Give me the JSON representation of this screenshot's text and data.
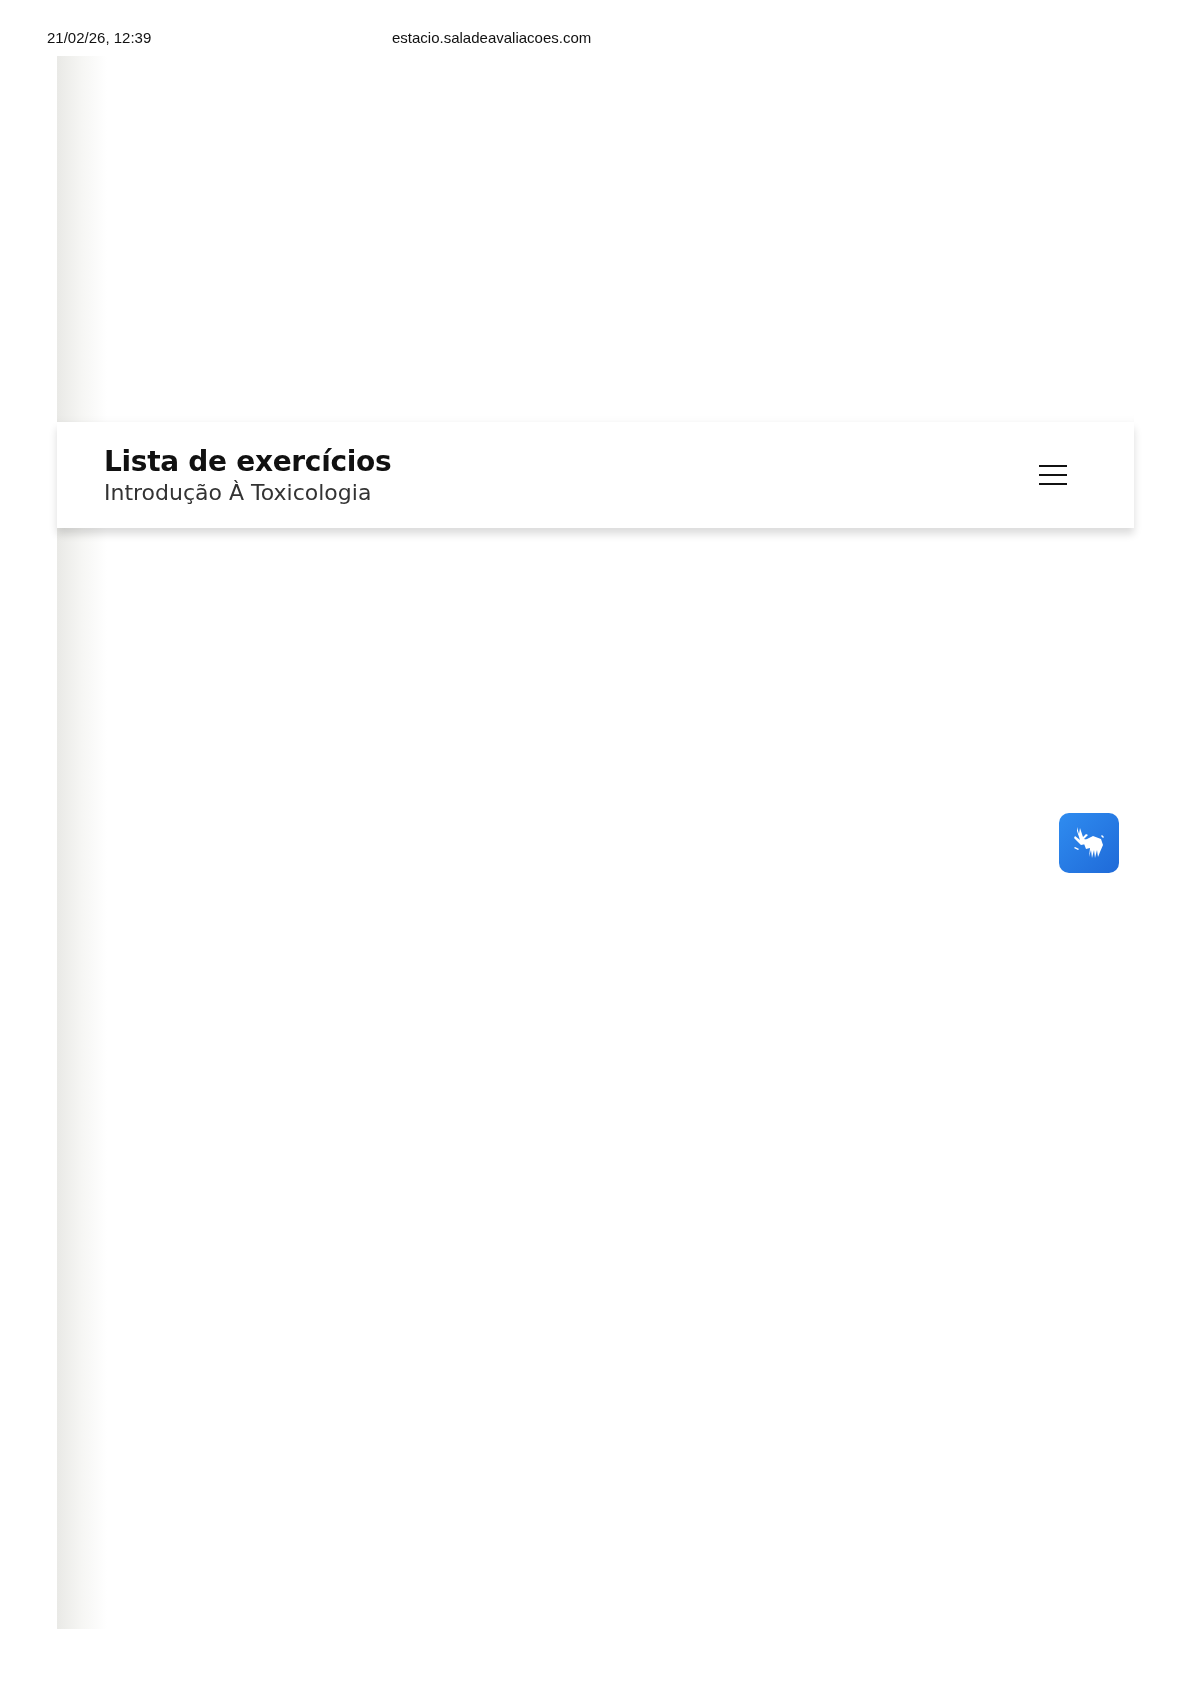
{
  "print_header": {
    "date_time": "21/02/26, 12:39",
    "url": "estacio.saladeavaliacoes.com"
  },
  "header": {
    "title": "Lista de exercícios",
    "subtitle": "Introdução À Toxicologia"
  }
}
